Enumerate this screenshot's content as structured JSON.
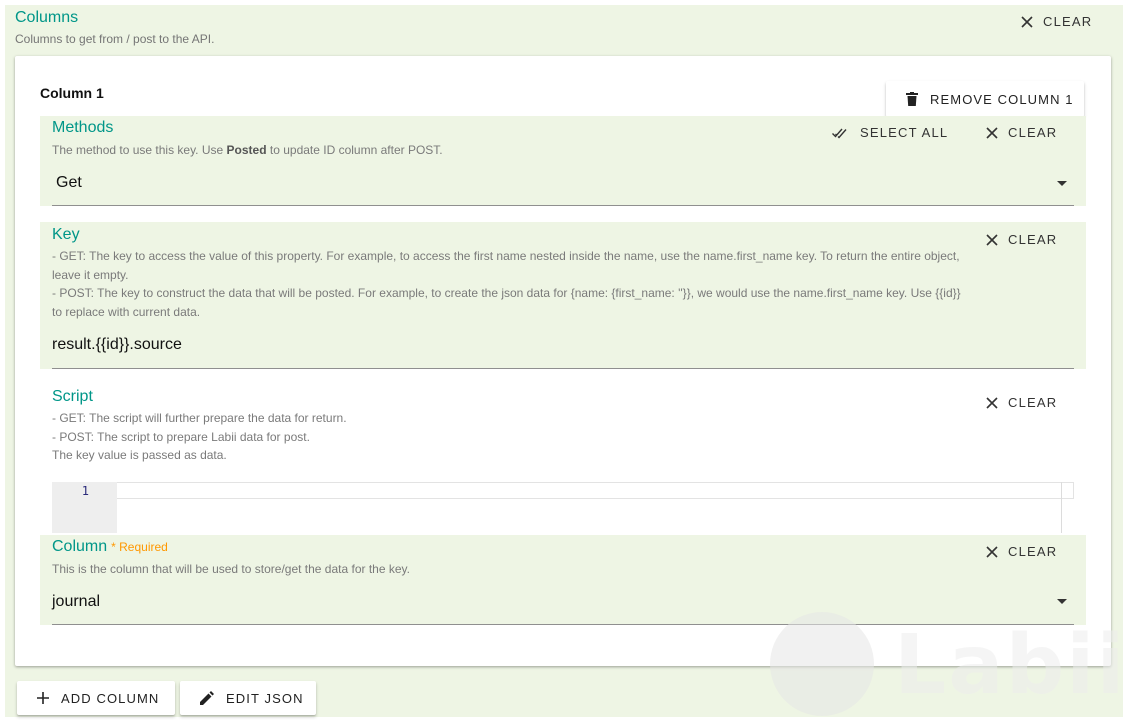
{
  "columns_section": {
    "title": "Columns",
    "description": "Columns to get from / post to the API.",
    "clear_label": "CLEAR"
  },
  "column_card": {
    "title": "Column 1",
    "remove_label": "REMOVE COLUMN 1"
  },
  "methods": {
    "title": "Methods",
    "desc_before": "The method to use this key. Use ",
    "desc_bold": "Posted",
    "desc_after": " to update ID column after POST.",
    "select_all_label": "SELECT ALL",
    "clear_label": "CLEAR",
    "value": "Get"
  },
  "key": {
    "title": "Key",
    "desc_lines": [
      "- GET: The key to access the value of this property. For example, to access the first name nested inside the name, use the name.first_name key. To return the entire object, leave it empty.",
      "- POST: The key to construct the data that will be posted. For example, to create the json data for {name: {first_name: ''}}, we would use the name.first_name key. Use {{id}} to replace with current data."
    ],
    "clear_label": "CLEAR",
    "value": "result.{{id}}.source"
  },
  "script": {
    "title": "Script",
    "desc_lines": [
      "- GET: The script will further prepare the data for return.",
      "- POST: The script to prepare Labii data for post.",
      "The key value is passed as data."
    ],
    "clear_label": "CLEAR",
    "line_number": "1"
  },
  "column": {
    "title": "Column",
    "required_label": "* Required",
    "description": "This is the column that will be used to store/get the data for the key.",
    "clear_label": "CLEAR",
    "value": "journal"
  },
  "actions": {
    "add_column_label": "ADD COLUMN",
    "edit_json_label": "EDIT JSON"
  },
  "watermark": {
    "text": "Labii"
  },
  "colors": {
    "accent": "#009688",
    "section_bg": "#eef5e4",
    "required": "#ff9800"
  }
}
